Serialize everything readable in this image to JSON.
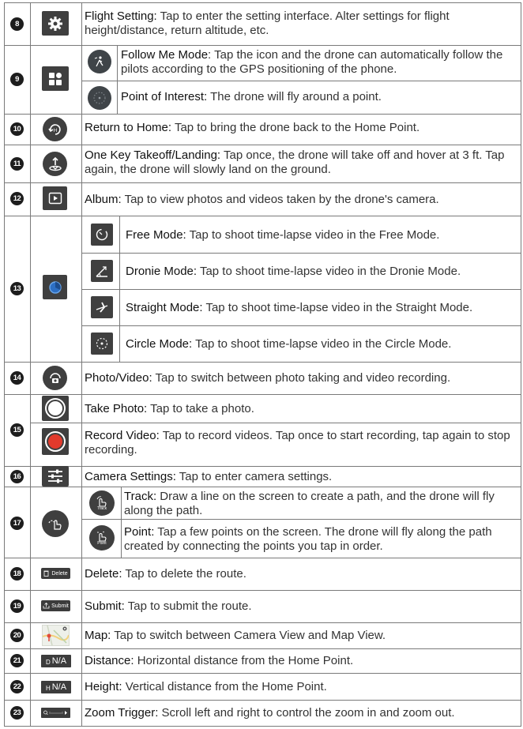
{
  "rows": [
    {
      "num": "8",
      "title": "Flight Setting:",
      "desc": " Tap to enter the setting interface. Alter settings for flight height/distance, return altitude, etc.",
      "icon": "gear-icon"
    },
    {
      "num": "9",
      "icon": "grid-icon",
      "subrows": [
        {
          "title": "Follow Me Mode",
          "desc": ": Tap the icon and the drone can automatically follow the pilots according to the GPS positioning of the phone.",
          "icon": "follow-me-icon"
        },
        {
          "title": "Point of Interest:",
          "desc": " The drone will fly around a point.",
          "icon": "point-of-interest-icon"
        }
      ]
    },
    {
      "num": "10",
      "title": "Return to Home:",
      "desc": " Tap to bring the drone back to the Home Point.",
      "icon": "return-home-icon"
    },
    {
      "num": "11",
      "title": "One Key Takeoff/Landing:",
      "desc": " Tap once, the drone will take off and hover at 3 ft. Tap again, the drone will slowly land on the ground.",
      "icon": "takeoff-landing-icon"
    },
    {
      "num": "12",
      "title": "Album:",
      "desc": " Tap to view photos and videos taken by the drone's camera.",
      "icon": "album-icon"
    },
    {
      "num": "13",
      "icon": "timelapse-icon",
      "subrows": [
        {
          "title": "Free Mode:",
          "desc": " Tap to shoot time-lapse video in the Free Mode.",
          "icon": "free-mode-icon"
        },
        {
          "title": "Dronie Mode:",
          "desc": " Tap to shoot time-lapse video in the Dronie Mode.",
          "icon": "dronie-mode-icon"
        },
        {
          "title": "Straight Mode:",
          "desc": " Tap to shoot time-lapse video in the Straight Mode.",
          "icon": "straight-mode-icon"
        },
        {
          "title": "Circle Mode:",
          "desc": " Tap to shoot time-lapse video in the Circle Mode.",
          "icon": "circle-mode-icon"
        }
      ]
    },
    {
      "num": "14",
      "title": "Photo/Video:",
      "desc": " Tap to switch between photo taking and video recording.",
      "icon": "photo-video-switch-icon"
    },
    {
      "num": "15",
      "subrows": [
        {
          "title": "Take Photo:",
          "desc": " Tap to take a photo.",
          "icon": "take-photo-icon"
        },
        {
          "title": "Record Video:",
          "desc": " Tap to record videos. Tap once to start recording, tap again to stop recording.",
          "icon": "record-video-icon"
        }
      ]
    },
    {
      "num": "16",
      "title": "Camera Settings:",
      "desc": " Tap to enter camera settings.",
      "icon": "sliders-icon"
    },
    {
      "num": "17",
      "icon": "route-hand-icon",
      "subrows": [
        {
          "title": "Track:",
          "desc": " Draw a line on the screen to create a path, and the drone will fly along the path.",
          "icon": "track-icon",
          "icon_label": "Track"
        },
        {
          "title": "Point:",
          "desc": " Tap a few points on the screen. The drone will fly along the path created by connecting the points you tap in order.",
          "icon": "point-icon",
          "icon_label": "Point"
        }
      ]
    },
    {
      "num": "18",
      "title": "Delete:",
      "desc": " Tap to delete the route.",
      "icon": "delete-icon",
      "icon_label": "Delete"
    },
    {
      "num": "19",
      "title": "Submit:",
      "desc": " Tap to submit the route.",
      "icon": "submit-icon",
      "icon_label": "Submit"
    },
    {
      "num": "20",
      "title": "Map:",
      "desc": " Tap to switch between Camera View and Map View.",
      "icon": "map-icon"
    },
    {
      "num": "21",
      "title": "Distance:",
      "desc": " Horizontal distance from the Home Point.",
      "icon": "distance-icon",
      "icon_prefix": "D",
      "icon_label": "N/A"
    },
    {
      "num": "22",
      "title": "Height:",
      "desc": " Vertical distance from the Home Point.",
      "icon": "height-icon",
      "icon_prefix": "H",
      "icon_label": "N/A"
    },
    {
      "num": "23",
      "title": "Zoom Trigger:",
      "desc": " Scroll left and right to control the zoom in and zoom out.",
      "icon": "zoom-slider-icon"
    }
  ]
}
